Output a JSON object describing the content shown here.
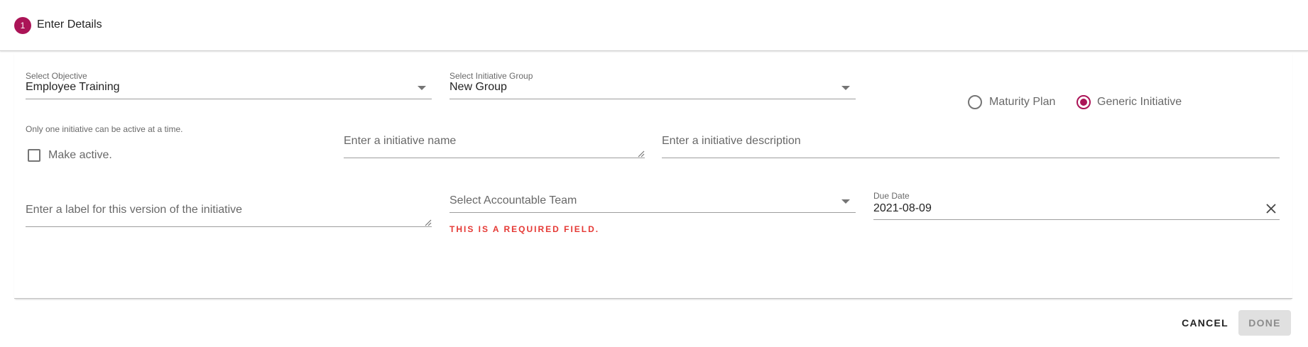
{
  "theme": {
    "accent": "#ab1457",
    "error": "#e53935"
  },
  "step": {
    "number": "1",
    "title": "Enter Details"
  },
  "form": {
    "objective": {
      "label": "Select Objective",
      "value": "Employee Training"
    },
    "initiative_group": {
      "label": "Select Initiative Group",
      "value": "New Group"
    },
    "initiative_type": {
      "options": [
        "Maturity Plan",
        "Generic Initiative"
      ],
      "selected": "Generic Initiative"
    },
    "active": {
      "hint": "Only one initiative can be active at a time.",
      "label": "Make active.",
      "checked": false
    },
    "initiative_name": {
      "placeholder": "Enter a initiative name",
      "value": ""
    },
    "initiative_description": {
      "placeholder": "Enter a initiative description",
      "value": ""
    },
    "version_label": {
      "placeholder": "Enter a label for this version of the initiative",
      "value": ""
    },
    "accountable_team": {
      "placeholder": "Select Accountable Team",
      "error": "This is a required field."
    },
    "due_date": {
      "label": "Due Date",
      "value": "2021-08-09"
    }
  },
  "actions": {
    "cancel": "CANCEL",
    "done": "DONE"
  },
  "icons": {
    "dropdown": "chevron-down-icon",
    "clear": "close-icon",
    "resize": "resize-handle-icon"
  }
}
